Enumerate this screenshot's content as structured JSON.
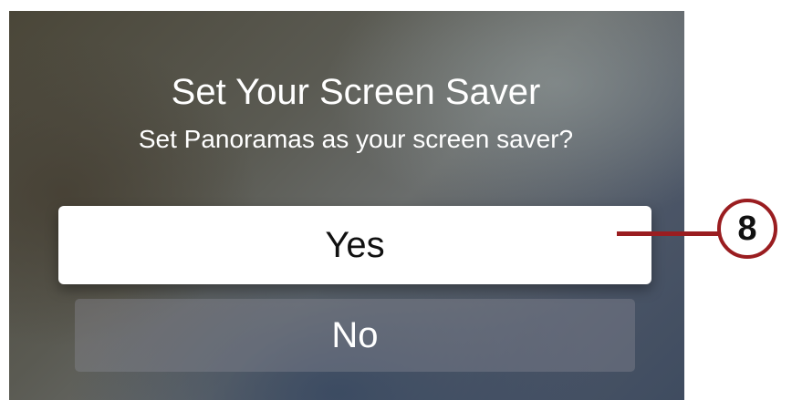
{
  "dialog": {
    "title": "Set Your Screen Saver",
    "subtitle": "Set Panoramas as your screen saver?",
    "yes_label": "Yes",
    "no_label": "No"
  },
  "callout": {
    "number": "8",
    "color": "#9a1d20"
  },
  "colors": {
    "yes_button_bg": "#ffffff",
    "text_on_dark": "#ffffff"
  }
}
